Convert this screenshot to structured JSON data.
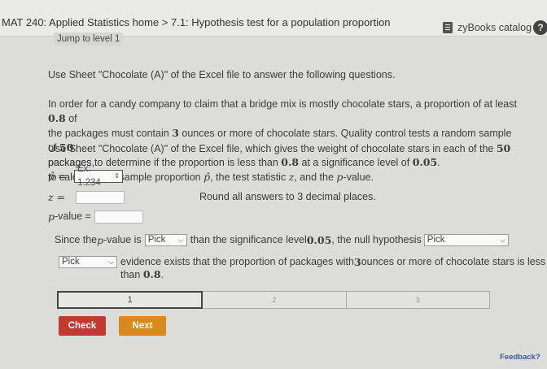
{
  "header": {
    "breadcrumb": "MAT 240: Applied Statistics home > 7.1: Hypothesis test for a population proportion",
    "catalog_label": "zyBooks catalog",
    "help_symbol": "?"
  },
  "jump_label": "Jump to level 1",
  "problem": {
    "intro": "Use Sheet \"Chocolate (A)\" of the Excel file to answer the following questions.",
    "para1_a": "In order for a candy company to claim that a bridge mix is mostly chocolate stars, a proportion of at least ",
    "para1_p": "0.8",
    "para1_b": " of",
    "para1_c": "the packages must contain ",
    "para1_three": "3",
    "para1_d": " ounces or more of chocolate stars. Quality control tests a random sample of ",
    "para1_fifty": "50",
    "para1_e": "packages to determine if the proportion is less than ",
    "para1_p2": "0.8",
    "para1_f": " at a significance level of ",
    "para1_alpha": "0.05",
    "para1_g": ".",
    "para2_a": "Use Sheet \"Chocolate (A)\" of the Excel file, which gives the weight of chocolate stars in each of the ",
    "para2_fifty": "50",
    "para2_b": " packages,",
    "para2_c": "to calculate the sample proportion ",
    "para2_phat": "p̂",
    "para2_d": ", the test statistic ",
    "para2_z": "z",
    "para2_e": ", and the ",
    "para2_pv": "p",
    "para2_f": "-value."
  },
  "fields": {
    "phat_label": "p̂ =",
    "phat_value": "Ex: 1.234",
    "z_label": "z =",
    "z_value": "",
    "pvalue_var": "p",
    "pvalue_label": "-value =",
    "pvalue_value": "",
    "round_note": "Round all answers to 3 decimal places."
  },
  "conclusion": {
    "s1_a": "Since the ",
    "s1_p": "p",
    "s1_b": "-value is",
    "select1": "Pick",
    "s1_c": "than the significance level ",
    "s1_alpha": "0.05",
    "s1_d": ", the null hypothesis",
    "select2": "Pick",
    "select3": "Pick",
    "s2_a": "evidence exists that the proportion of packages with ",
    "s2_three": "3",
    "s2_b": " ounces or more of chocolate stars is less",
    "s2_c": "than ",
    "s2_p": "0.8",
    "s2_d": "."
  },
  "levels": [
    "1",
    "2",
    "3"
  ],
  "buttons": {
    "check": "Check",
    "next": "Next"
  },
  "feedback": "Feedback?",
  "colors": {
    "check": "#c13a2f",
    "next": "#d98a1e",
    "feedback": "#3c5aa6"
  }
}
